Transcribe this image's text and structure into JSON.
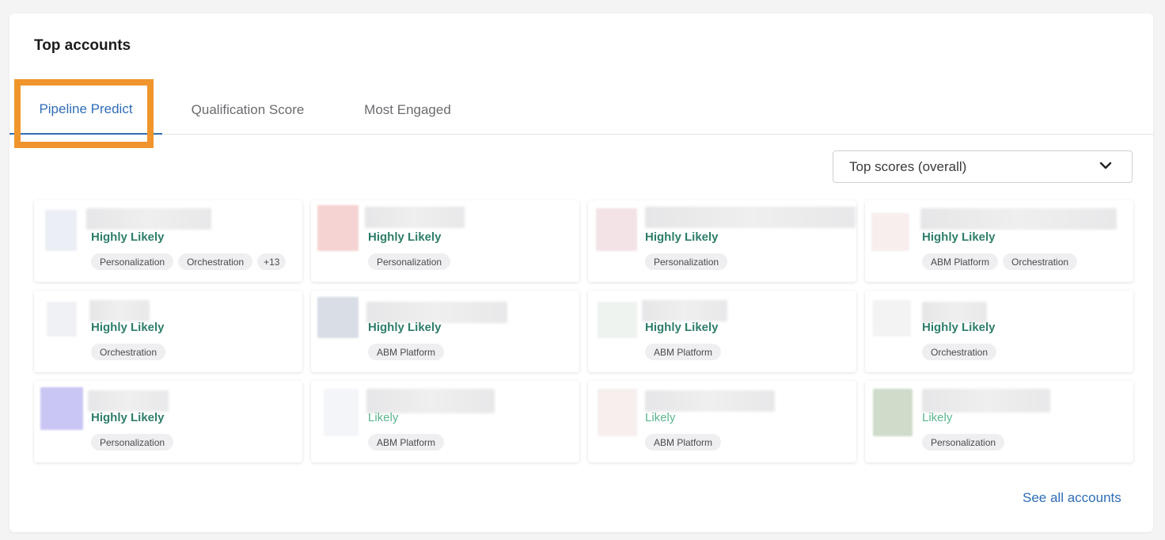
{
  "widget": {
    "title": "Top accounts",
    "see_all_label": "See all accounts"
  },
  "tabs": [
    {
      "label": "Pipeline Predict",
      "active": true
    },
    {
      "label": "Qualification Score",
      "active": false
    },
    {
      "label": "Most Engaged",
      "active": false
    }
  ],
  "filter": {
    "selected": "Top scores (overall)",
    "icon": "chevron-down-icon"
  },
  "colors": {
    "accent": "#2f6db5",
    "highly_likely": "#2e7d6a",
    "likely": "#5bb58d",
    "annotation_box": "#f0952b"
  },
  "accounts": [
    {
      "score": "Highly Likely",
      "tags": [
        "Personalization",
        "Orchestration",
        "+13"
      ]
    },
    {
      "score": "Highly Likely",
      "tags": [
        "Personalization"
      ]
    },
    {
      "score": "Highly Likely",
      "tags": [
        "Personalization"
      ]
    },
    {
      "score": "Highly Likely",
      "tags": [
        "ABM Platform",
        "Orchestration"
      ]
    },
    {
      "score": "Highly Likely",
      "tags": [
        "Orchestration"
      ]
    },
    {
      "score": "Highly Likely",
      "tags": [
        "ABM Platform"
      ]
    },
    {
      "score": "Highly Likely",
      "tags": [
        "ABM Platform"
      ]
    },
    {
      "score": "Highly Likely",
      "tags": [
        "Orchestration"
      ]
    },
    {
      "score": "Highly Likely",
      "tags": [
        "Personalization"
      ]
    },
    {
      "score": "Likely",
      "tags": [
        "ABM Platform"
      ]
    },
    {
      "score": "Likely",
      "tags": [
        "ABM Platform"
      ]
    },
    {
      "score": "Likely",
      "tags": [
        "Personalization"
      ]
    }
  ]
}
